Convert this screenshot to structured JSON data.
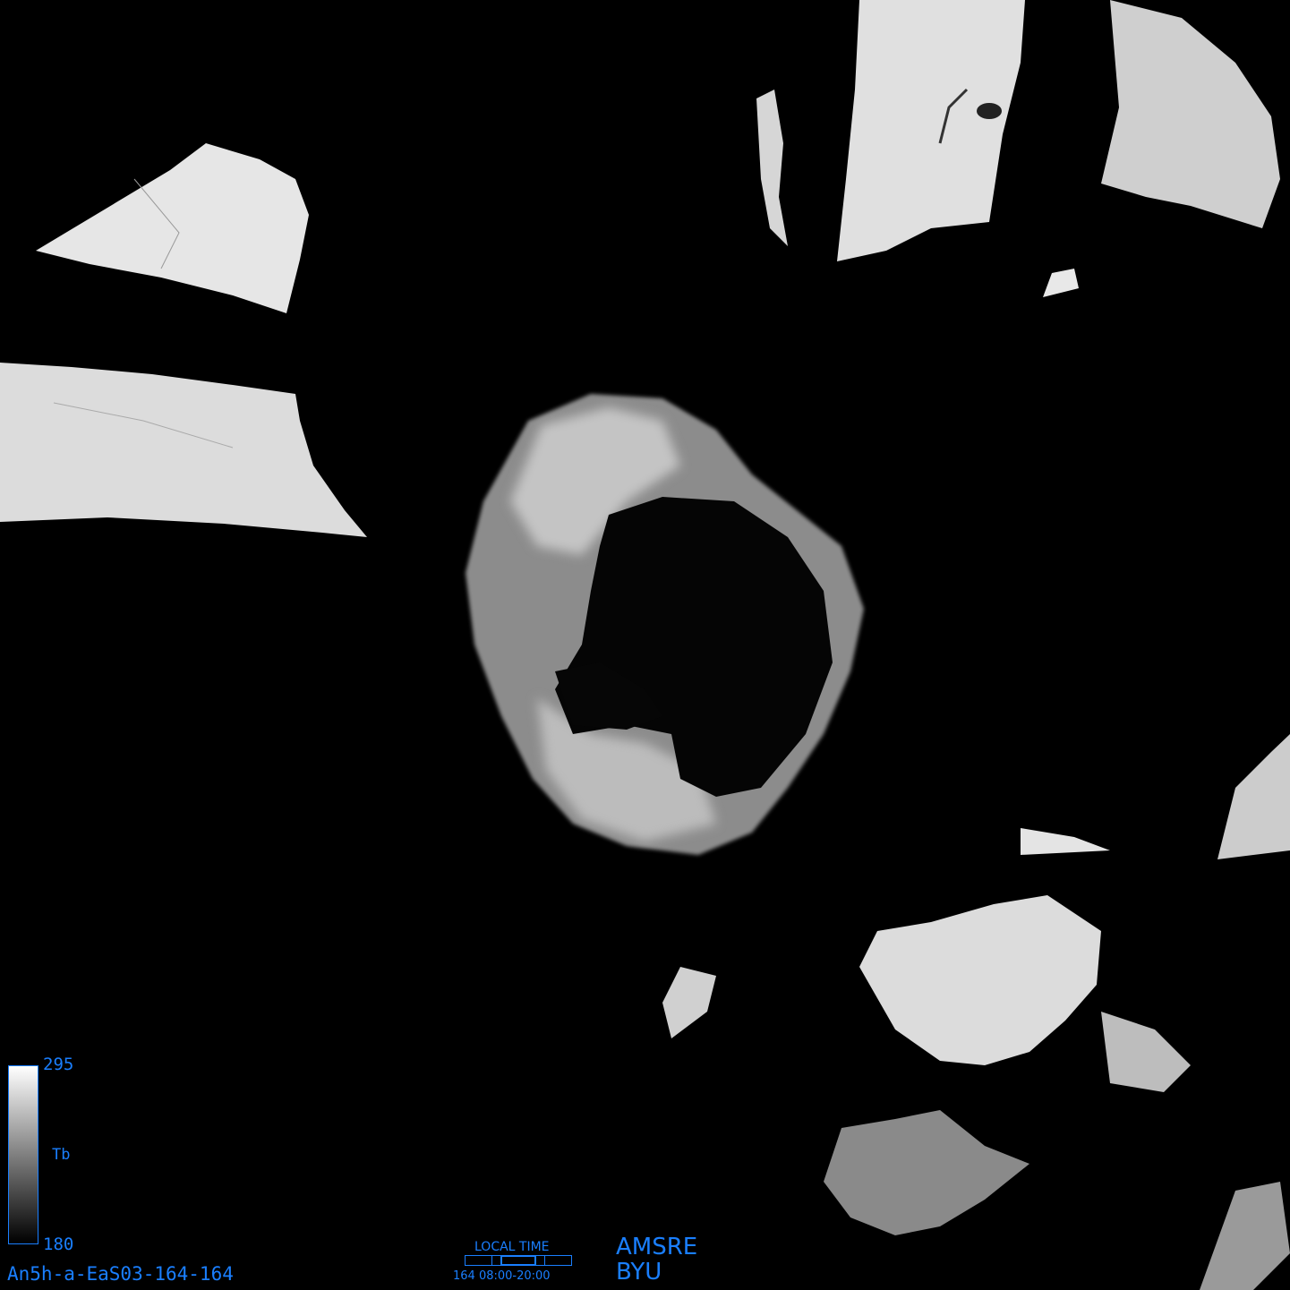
{
  "colorbar": {
    "max": "295",
    "variable": "Tb",
    "min": "180",
    "gradient_top": "#ffffff",
    "gradient_bottom": "#000000"
  },
  "image_id": "An5h-a-EaS03-164-164",
  "local_time": {
    "label": "LOCAL TIME",
    "range": "164 08:00-20:00"
  },
  "sensor": "AMSRE",
  "organization": "BYU",
  "accent_color": "#1a7fff"
}
